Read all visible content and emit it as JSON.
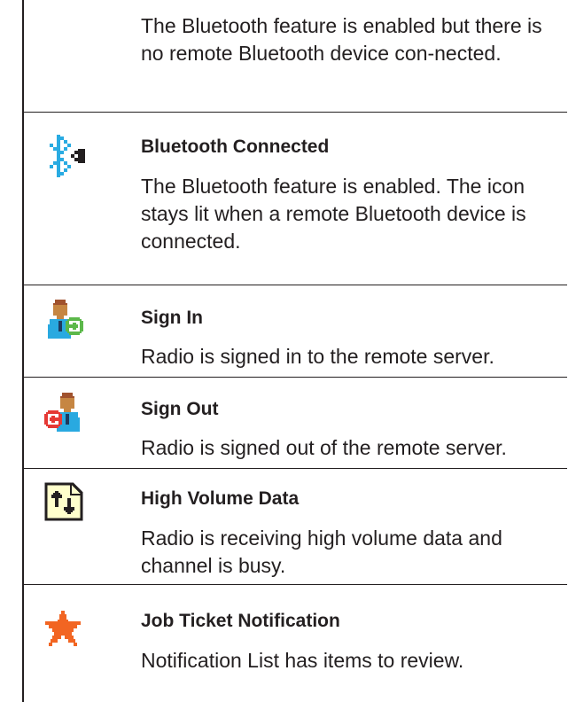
{
  "rows": [
    {
      "icon": "bluetooth-on-icon",
      "title": "",
      "description": "The Bluetooth feature is enabled but there is no remote Bluetooth device con-nected."
    },
    {
      "icon": "bluetooth-connected-icon",
      "title": "Bluetooth Connected",
      "description": "The Bluetooth feature is enabled. The icon stays lit when a remote Bluetooth device is connected."
    },
    {
      "icon": "sign-in-icon",
      "title": "Sign In",
      "description": "Radio is signed in to the remote server."
    },
    {
      "icon": "sign-out-icon",
      "title": "Sign Out",
      "description": "Radio is signed out of the remote server."
    },
    {
      "icon": "high-volume-data-icon",
      "title": "High Volume Data",
      "description": "Radio is receiving high volume data and channel is busy."
    },
    {
      "icon": "job-ticket-notification-icon",
      "title": "Job Ticket Notification",
      "description": "Notification List has items to review."
    }
  ],
  "colors": {
    "text": "#231f20",
    "bluetooth": "#29abe2",
    "skin": "#c68642",
    "user_body": "#29a9e0",
    "sign_in_arrow": "#5cb84a",
    "sign_out_arrow": "#e53935",
    "data_doc_fill": "#ffffcc",
    "star": "#f26522"
  }
}
